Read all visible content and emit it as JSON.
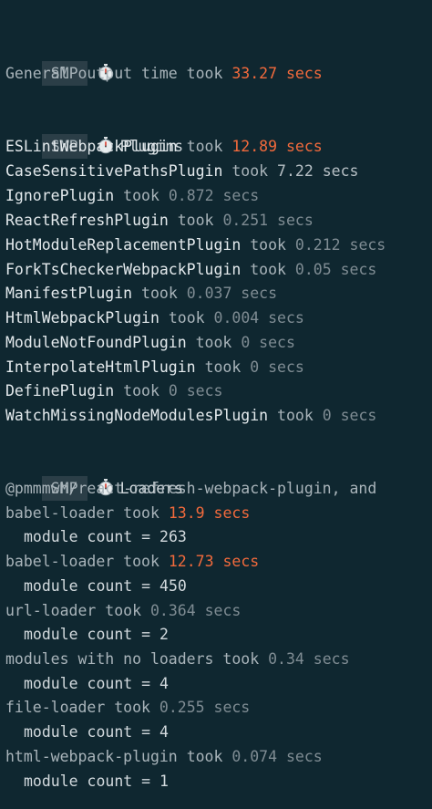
{
  "badge": "SMP",
  "general": {
    "label": "General output time took",
    "time": "33.27 secs"
  },
  "plugins": {
    "title": "Plugins",
    "took": "took",
    "items": [
      {
        "name": "ESLintWebpackPlugin",
        "time": "12.89 secs"
      },
      {
        "name": "CaseSensitivePathsPlugin",
        "time": "7.22 secs"
      },
      {
        "name": "IgnorePlugin",
        "time": "0.872 secs"
      },
      {
        "name": "ReactRefreshPlugin",
        "time": "0.251 secs"
      },
      {
        "name": "HotModuleReplacementPlugin",
        "time": "0.212 secs"
      },
      {
        "name": "ForkTsCheckerWebpackPlugin",
        "time": "0.05 secs"
      },
      {
        "name": "ManifestPlugin",
        "time": "0.037 secs"
      },
      {
        "name": "HtmlWebpackPlugin",
        "time": "0.004 secs"
      },
      {
        "name": "ModuleNotFoundPlugin",
        "time": "0 secs"
      },
      {
        "name": "InterpolateHtmlPlugin",
        "time": "0 secs"
      },
      {
        "name": "DefinePlugin",
        "time": "0 secs"
      },
      {
        "name": "WatchMissingNodeModulesPlugin",
        "time": "0 secs"
      }
    ]
  },
  "loaders": {
    "title": "Loaders",
    "took": "took",
    "preface": "@pmmmwh/react-refresh-webpack-plugin, and",
    "items": [
      {
        "name": "babel-loader",
        "time": "13.9 secs",
        "count": "module count = 263"
      },
      {
        "name": "babel-loader",
        "time": "12.73 secs",
        "count": "module count = 450"
      },
      {
        "name": "url-loader",
        "time": "0.364 secs",
        "count": "module count = 2"
      },
      {
        "name": "modules with no loaders",
        "time": "0.34 secs",
        "count": "module count = 4"
      },
      {
        "name": "file-loader",
        "time": "0.255 secs",
        "count": "module count = 4"
      },
      {
        "name": "html-webpack-plugin",
        "time": "0.074 secs",
        "count": "module count = 1"
      }
    ]
  },
  "colors": {
    "background": "#0f2730",
    "slow": "#f26a3c",
    "badge_bg": "#2b3e47"
  },
  "icons": {
    "section": "stopwatch-icon"
  }
}
